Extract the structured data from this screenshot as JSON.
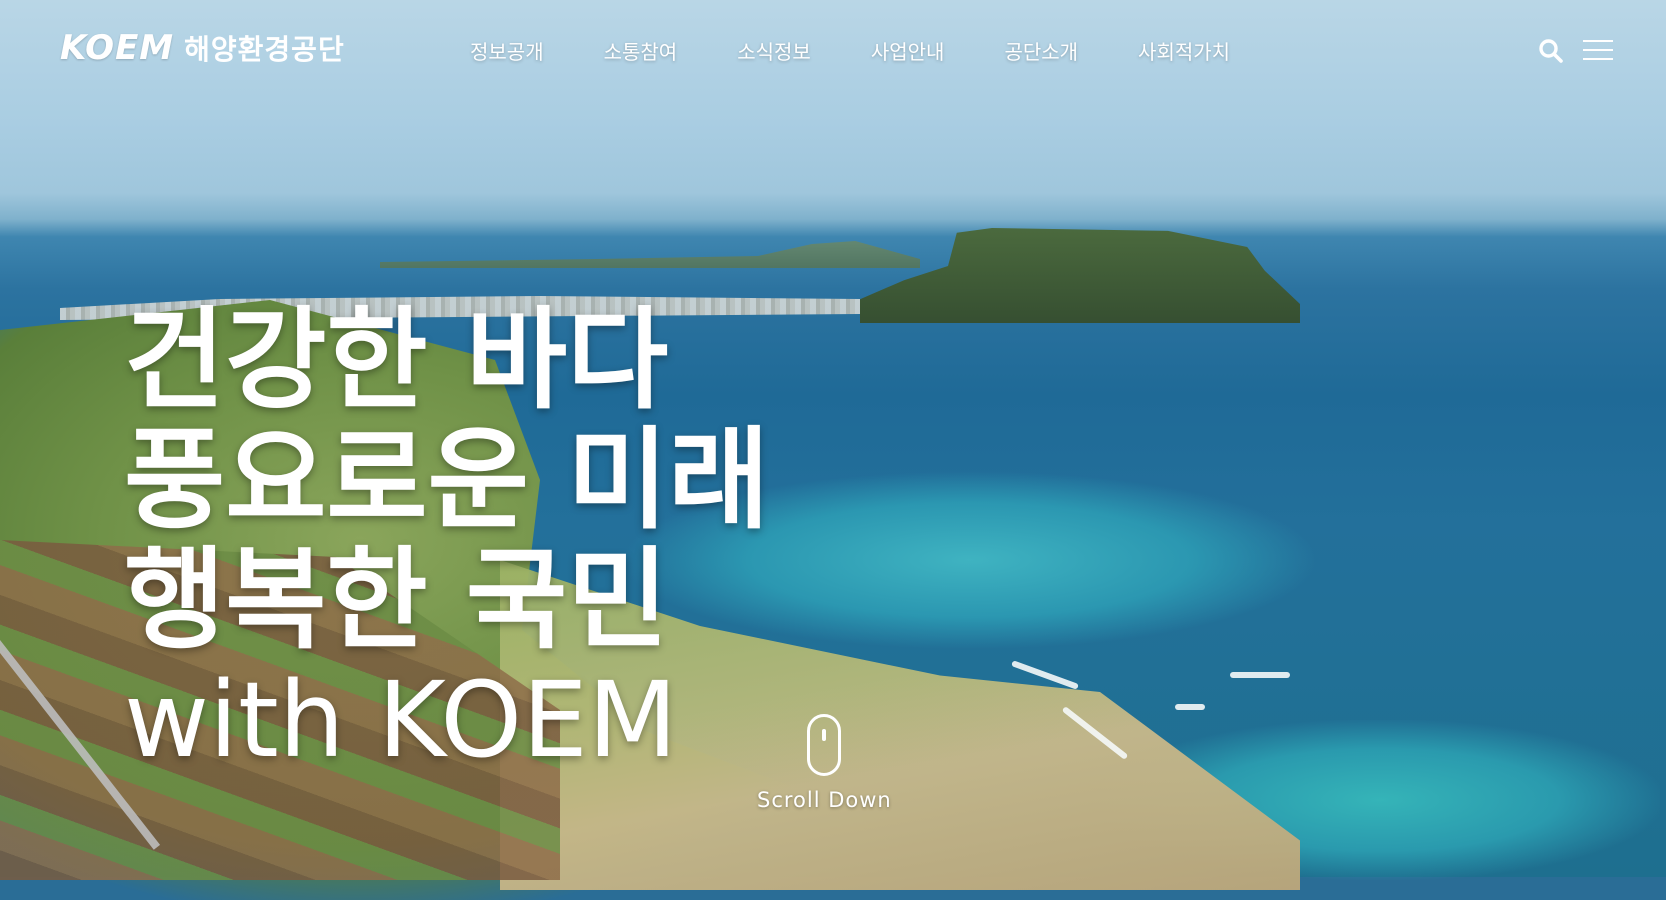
{
  "header": {
    "logo_mark": "KOEM",
    "logo_text": "해양환경공단",
    "nav": [
      {
        "label": "정보공개"
      },
      {
        "label": "소통참여"
      },
      {
        "label": "소식정보"
      },
      {
        "label": "사업안내"
      },
      {
        "label": "공단소개"
      },
      {
        "label": "사회적가치"
      }
    ],
    "icons": {
      "search": "search-icon",
      "menu": "hamburger-menu-icon"
    }
  },
  "hero": {
    "line1": "건강한 바다",
    "line2": "풍요로운 미래",
    "line3": "행복한 국민",
    "line4": "with KOEM"
  },
  "scroll": {
    "label": "Scroll Down",
    "icon": "mouse-icon"
  },
  "colors": {
    "text": "#ffffff",
    "sky": "#a9cde2",
    "sea": "#1f6a97",
    "shallow_sea": "#3fb3c1"
  }
}
